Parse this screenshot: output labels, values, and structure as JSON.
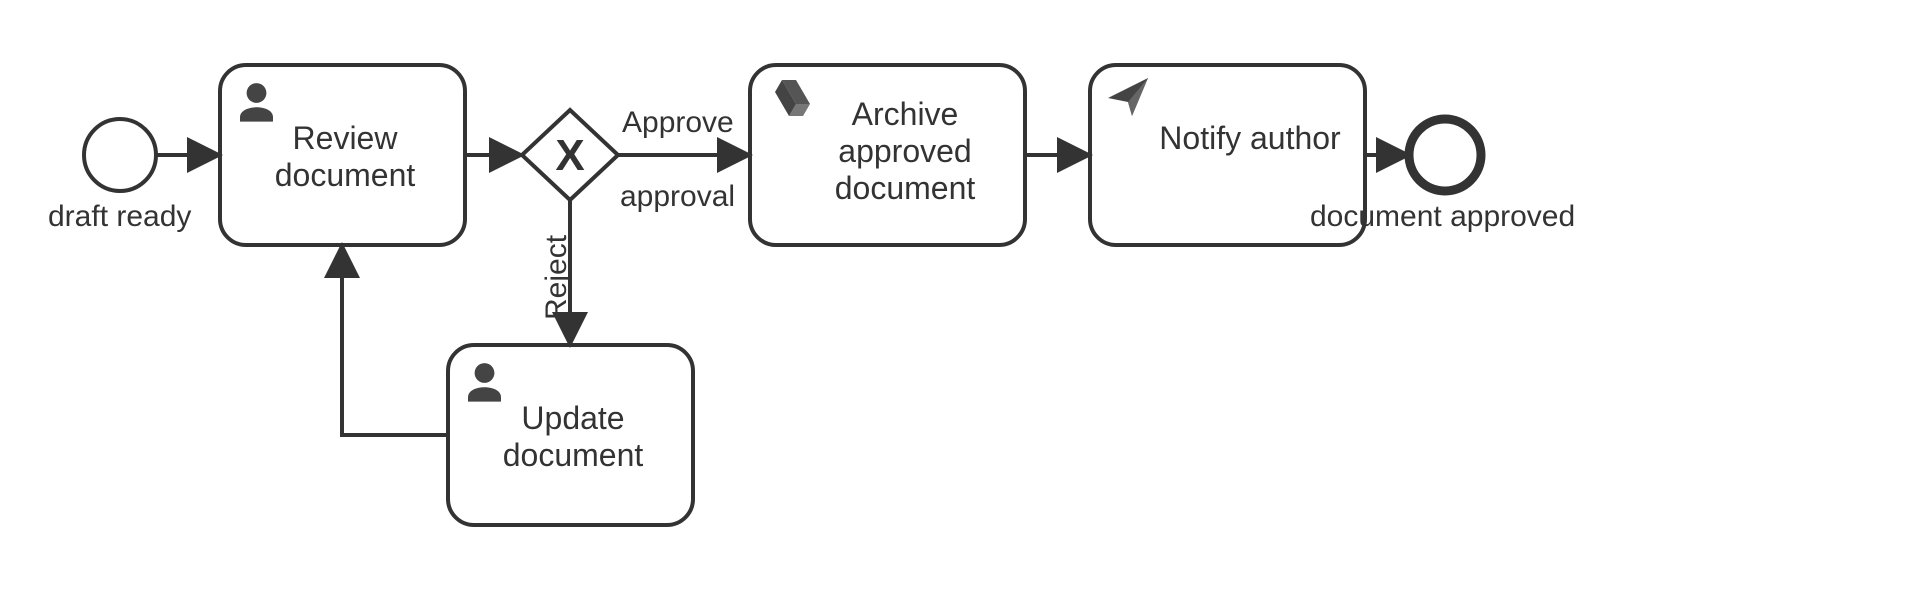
{
  "diagram": {
    "type": "BPMN",
    "start_event": {
      "label": "draft ready"
    },
    "end_event": {
      "label": "document approved"
    },
    "tasks": {
      "review": {
        "label": "Review document",
        "icon": "user"
      },
      "update": {
        "label": "Update document",
        "icon": "user"
      },
      "archive": {
        "label": "Archive approved document",
        "icon": "drive"
      },
      "notify": {
        "label": "Notify author",
        "icon": "send"
      }
    },
    "gateway": {
      "label": "approval",
      "type": "exclusive"
    },
    "flows": {
      "approve": {
        "label": "Approve"
      },
      "reject": {
        "label": "Reject"
      }
    }
  }
}
